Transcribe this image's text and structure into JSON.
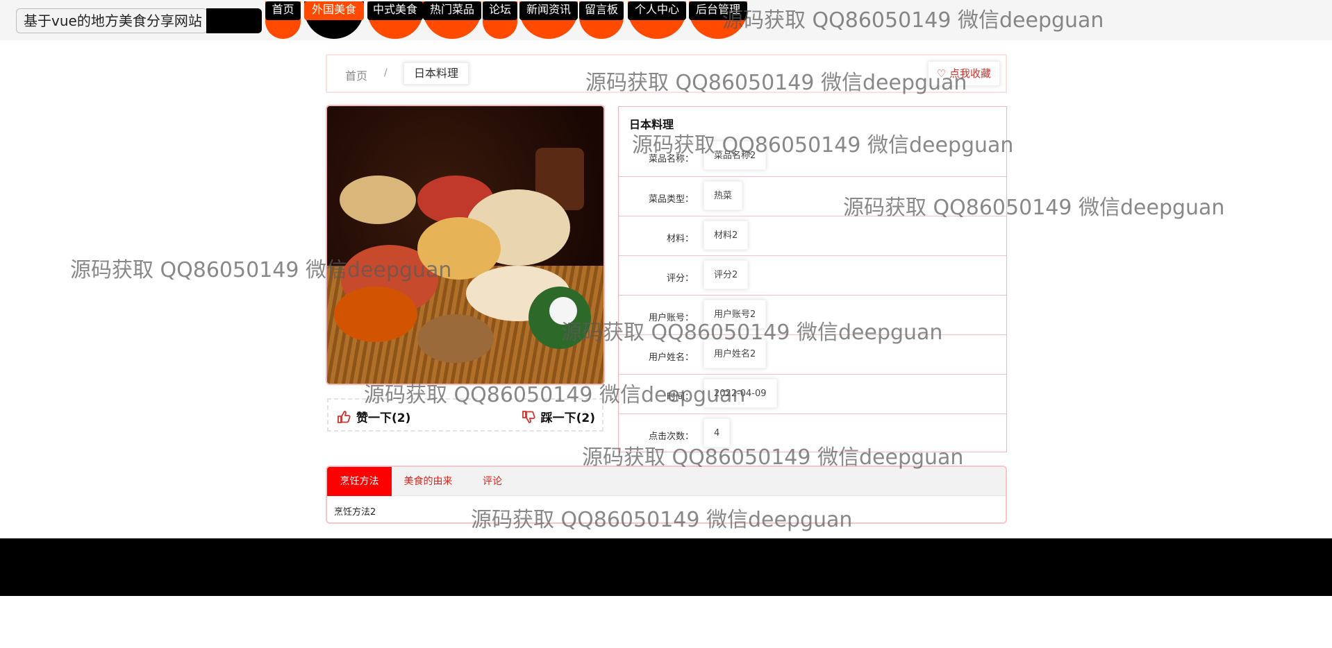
{
  "header": {
    "site_title": "基于vue的地方美食分享网站",
    "nav": [
      {
        "label": "首页",
        "active": false
      },
      {
        "label": "外国美食",
        "active": true
      },
      {
        "label": "中式美食",
        "active": false
      },
      {
        "label": "热门菜品",
        "active": false
      },
      {
        "label": "论坛",
        "active": false
      },
      {
        "label": "新闻资讯",
        "active": false
      },
      {
        "label": "留言板",
        "active": false
      },
      {
        "label": "个人中心",
        "active": false
      },
      {
        "label": "后台管理",
        "active": false
      }
    ]
  },
  "breadcrumb": {
    "home": "首页",
    "separator": "/",
    "current": "日本料理",
    "collect_label": "点我收藏"
  },
  "votes": {
    "up_label": "赞一下(2)",
    "down_label": "踩一下(2)"
  },
  "detail": {
    "title": "日本料理",
    "rows": [
      {
        "label": "菜品名称：",
        "value": "菜品名称2"
      },
      {
        "label": "菜品类型：",
        "value": "热菜"
      },
      {
        "label": "材料：",
        "value": "材料2"
      },
      {
        "label": "评分：",
        "value": "评分2"
      },
      {
        "label": "用户账号：",
        "value": "用户账号2"
      },
      {
        "label": "用户姓名：",
        "value": "用户姓名2"
      },
      {
        "label": "时间：",
        "value": "2022-04-09"
      },
      {
        "label": "点击次数：",
        "value": "4"
      }
    ]
  },
  "tabs": {
    "items": [
      {
        "label": "烹饪方法",
        "active": true
      },
      {
        "label": "美食的由来",
        "active": false
      },
      {
        "label": "评论",
        "active": false
      }
    ],
    "content": "烹饪方法2"
  },
  "watermark": "源码获取 QQ86050149 微信deepguan",
  "colors": {
    "accent": "#ff4a00",
    "tab_active": "#ff0000",
    "border_pink": "#f4b8b8"
  }
}
